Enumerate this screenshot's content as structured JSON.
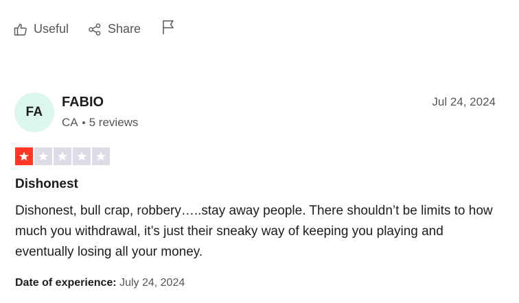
{
  "actions": {
    "useful_label": "Useful",
    "share_label": "Share"
  },
  "review": {
    "reviewer": {
      "initials": "FA",
      "name": "FABIO",
      "country": "CA",
      "reviews_count": "5 reviews"
    },
    "date": "Jul 24, 2024",
    "rating": {
      "value": 1,
      "max": 5
    },
    "title": "Dishonest",
    "body": "Dishonest, bull crap, robbery…..stay away people. There shouldn’t be limits to how much you withdrawal, it’s just their sneaky way of keeping you playing and eventually losing all your money.",
    "experience_label": "Date of experience:",
    "experience_date": "July 24, 2024"
  },
  "colors": {
    "star_filled": "#ff3722",
    "star_empty": "#dcdce6",
    "avatar_bg": "#dcf7ec"
  },
  "icons": [
    "thumbs-up-icon",
    "share-icon",
    "flag-icon",
    "star-icon"
  ]
}
